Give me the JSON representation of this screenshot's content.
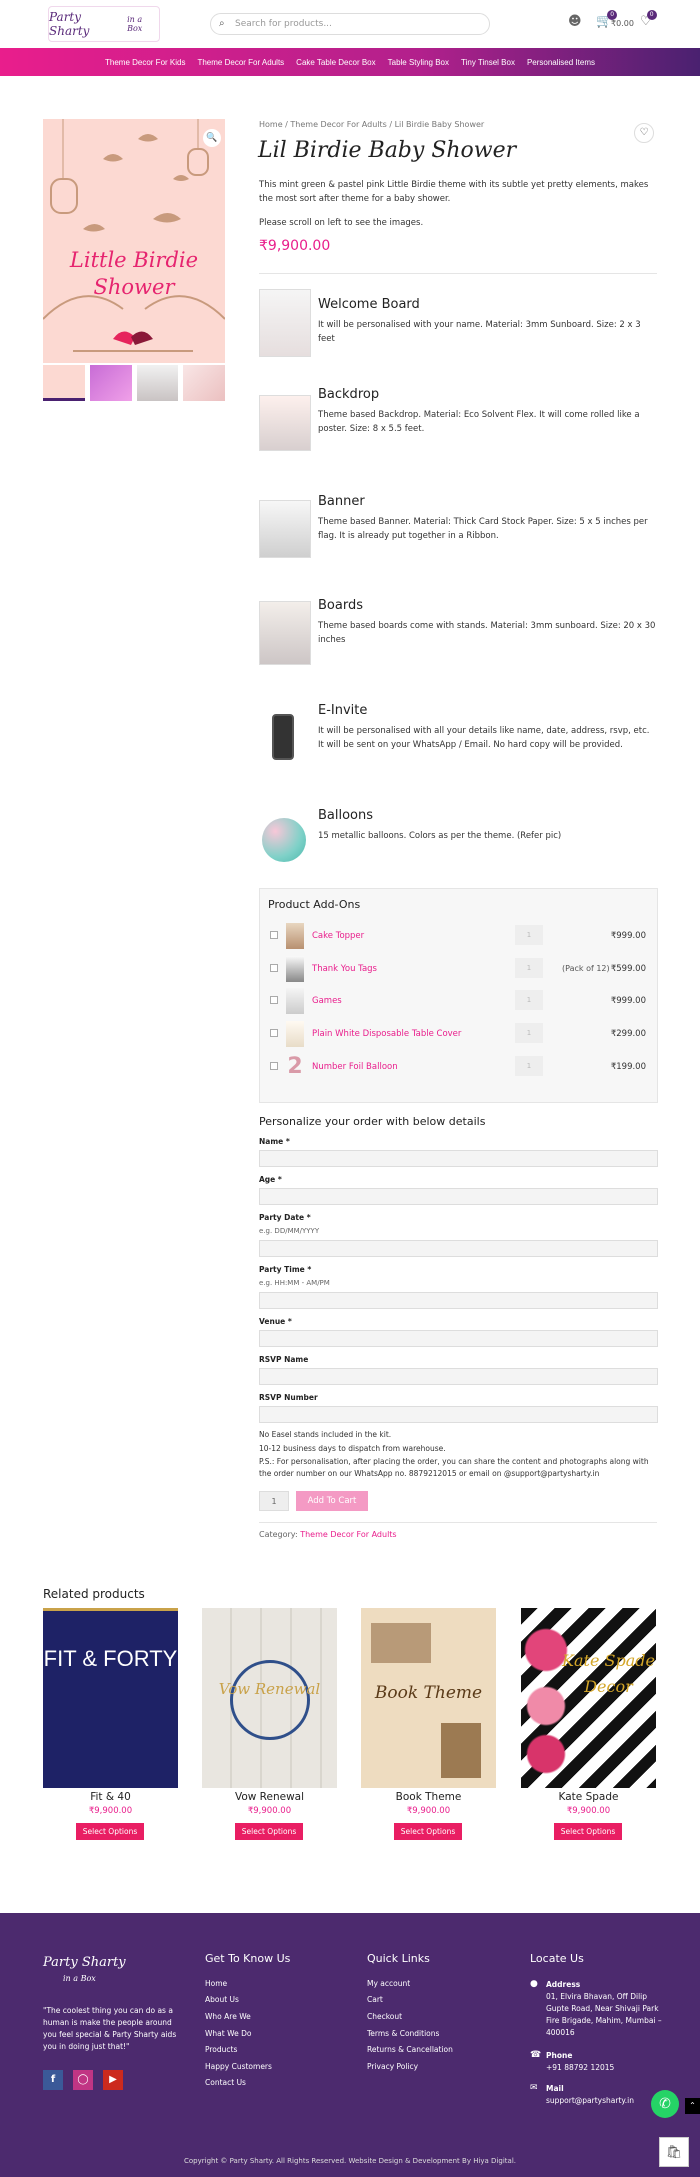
{
  "header": {
    "logo_text": "Party Sharty",
    "logo_sub": "in a Box",
    "search_placeholder": "Search for products...",
    "cart_total": "₹0.00",
    "cart_count": "0",
    "wishlist_count": "0"
  },
  "nav": [
    "Theme Decor For Kids",
    "Theme Decor For Adults",
    "Cake Table Decor Box",
    "Table Styling Box",
    "Tiny Tinsel Box",
    "Personalised Items"
  ],
  "product": {
    "main_image_text": "Little Birdie Shower",
    "breadcrumb": "Home / Theme Decor For Adults / Lil Birdie Baby Shower",
    "title": "Lil Birdie Baby Shower",
    "description": "This mint green & pastel pink Little Birdie theme with its subtle yet pretty elements, makes the most sort after theme for a baby shower.",
    "scroll_note": "Please scroll on left to see the images.",
    "price": "₹9,900.00"
  },
  "features": [
    {
      "title": "Welcome Board",
      "text": "It will be personalised with your name. Material: 3mm Sunboard. Size: 2 x 3 feet"
    },
    {
      "title": "Backdrop",
      "text": "Theme based Backdrop. Material: Eco Solvent Flex. It will come rolled like a poster. Size: 8 x 5.5 feet."
    },
    {
      "title": "Banner",
      "text": "Theme based Banner. Material: Thick Card Stock Paper. Size: 5 x 5 inches per flag. It is already put together in a Ribbon."
    },
    {
      "title": "Boards",
      "text": "Theme based boards come with stands. Material: 3mm sunboard. Size: 20 x 30 inches"
    },
    {
      "title": "E-Invite",
      "text": "It will be personalised with all your details like name, date, address, rsvp, etc. It will be sent on your WhatsApp / Email. No hard copy will be provided."
    },
    {
      "title": "Balloons",
      "text": "15 metallic balloons. Colors as per the theme. (Refer pic)"
    }
  ],
  "addons": {
    "title": "Product Add-Ons",
    "items": [
      {
        "name": "Cake Topper",
        "qty": "1",
        "pack": "",
        "price": "₹999.00"
      },
      {
        "name": "Thank You Tags",
        "qty": "1",
        "pack": "(Pack of 12)",
        "price": "₹599.00"
      },
      {
        "name": "Games",
        "qty": "1",
        "pack": "",
        "price": "₹999.00"
      },
      {
        "name": "Plain White Disposable Table Cover",
        "qty": "1",
        "pack": "",
        "price": "₹299.00"
      },
      {
        "name": "Number Foil Balloon",
        "qty": "1",
        "pack": "",
        "price": "₹199.00"
      }
    ]
  },
  "personalize": {
    "title": "Personalize your order with below details",
    "name_label": "Name *",
    "age_label": "Age *",
    "date_label": "Party Date *",
    "date_hint": "e.g. DD/MM/YYYY",
    "time_label": "Party Time *",
    "time_hint": "e.g. HH:MM - AM/PM",
    "venue_label": "Venue *",
    "rsvp_name_label": "RSVP Name",
    "rsvp_number_label": "RSVP Number",
    "note1": "No Easel stands included in the kit.",
    "note2": "10-12 business days to dispatch from warehouse.",
    "note3": "P.S.: For personalisation, after placing the order, you can share the content and photographs along with the order number on our WhatsApp no. 8879212015 or email on @support@partysharty.in"
  },
  "cart": {
    "qty": "1",
    "add_label": "Add To Cart"
  },
  "category": {
    "label": "Category: ",
    "value": "Theme Decor For Adults"
  },
  "related": {
    "title": "Related products",
    "items": [
      {
        "name": "Fit & 40",
        "image_text": "FIT & FORTY",
        "price": "₹9,900.00",
        "button": "Select Options"
      },
      {
        "name": "Vow Renewal",
        "image_text": "Vow Renewal",
        "price": "₹9,900.00",
        "button": "Select Options"
      },
      {
        "name": "Book Theme",
        "image_text": "Book Theme",
        "price": "₹9,900.00",
        "button": "Select Options"
      },
      {
        "name": "Kate Spade",
        "image_text": "Kate Spade Decor",
        "price": "₹9,900.00",
        "button": "Select Options"
      }
    ]
  },
  "footer": {
    "logo_text": "Party Sharty",
    "logo_sub": "in a Box",
    "quote": "\"The coolest thing you can do as a human is make the people around you feel special & Party Sharty aids you in doing just that!\"",
    "col1_title": "Get To Know Us",
    "col1_links": [
      "Home",
      "About Us",
      "Who Are We",
      "What We Do",
      "Products",
      "Happy Customers",
      "Contact Us"
    ],
    "col2_title": "Quick Links",
    "col2_links": [
      "My account",
      "Cart",
      "Checkout",
      "Terms & Conditions",
      "Returns & Cancellation",
      "Privacy Policy"
    ],
    "col3_title": "Locate Us",
    "address_label": "Address",
    "address": "01, Elvira Bhavan, Off Dilip Gupte Road, Near Shivaji Park Fire Brigade, Mahim, Mumbai – 400016",
    "phone_label": "Phone",
    "phone": "+91 88792 12015",
    "mail_label": "Mail",
    "mail": "support@partysharty.in",
    "copyright": "Copyright © Party Sharty. All Rights Reserved. Website Design & Development By Hiya Digital."
  }
}
